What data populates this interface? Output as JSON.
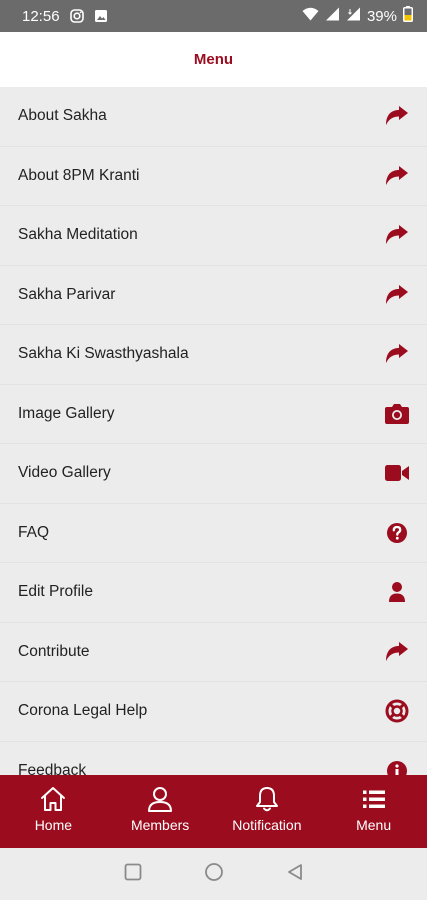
{
  "status_bar": {
    "time": "12:56",
    "battery": "39%"
  },
  "header": {
    "title": "Menu"
  },
  "menu_items": [
    {
      "label": "About Sakha",
      "icon": "share-arrow-icon"
    },
    {
      "label": "About 8PM Kranti",
      "icon": "share-arrow-icon"
    },
    {
      "label": "Sakha Meditation",
      "icon": "share-arrow-icon"
    },
    {
      "label": "Sakha Parivar",
      "icon": "share-arrow-icon"
    },
    {
      "label": "Sakha Ki Swasthyashala",
      "icon": "share-arrow-icon"
    },
    {
      "label": "Image Gallery",
      "icon": "camera-icon"
    },
    {
      "label": "Video Gallery",
      "icon": "video-camera-icon"
    },
    {
      "label": "FAQ",
      "icon": "question-circle-icon"
    },
    {
      "label": "Edit Profile",
      "icon": "user-icon"
    },
    {
      "label": "Contribute",
      "icon": "share-arrow-icon"
    },
    {
      "label": "Corona Legal Help",
      "icon": "lifebuoy-icon"
    },
    {
      "label": "Feedback",
      "icon": "info-circle-icon"
    }
  ],
  "bottom_nav": [
    {
      "label": "Home",
      "icon": "home-icon"
    },
    {
      "label": "Members",
      "icon": "person-icon"
    },
    {
      "label": "Notification",
      "icon": "bell-icon"
    },
    {
      "label": "Menu",
      "icon": "list-icon"
    }
  ],
  "colors": {
    "accent": "#9b0c1e",
    "status_bar": "#6b6b6b",
    "list_bg": "#ececec"
  }
}
